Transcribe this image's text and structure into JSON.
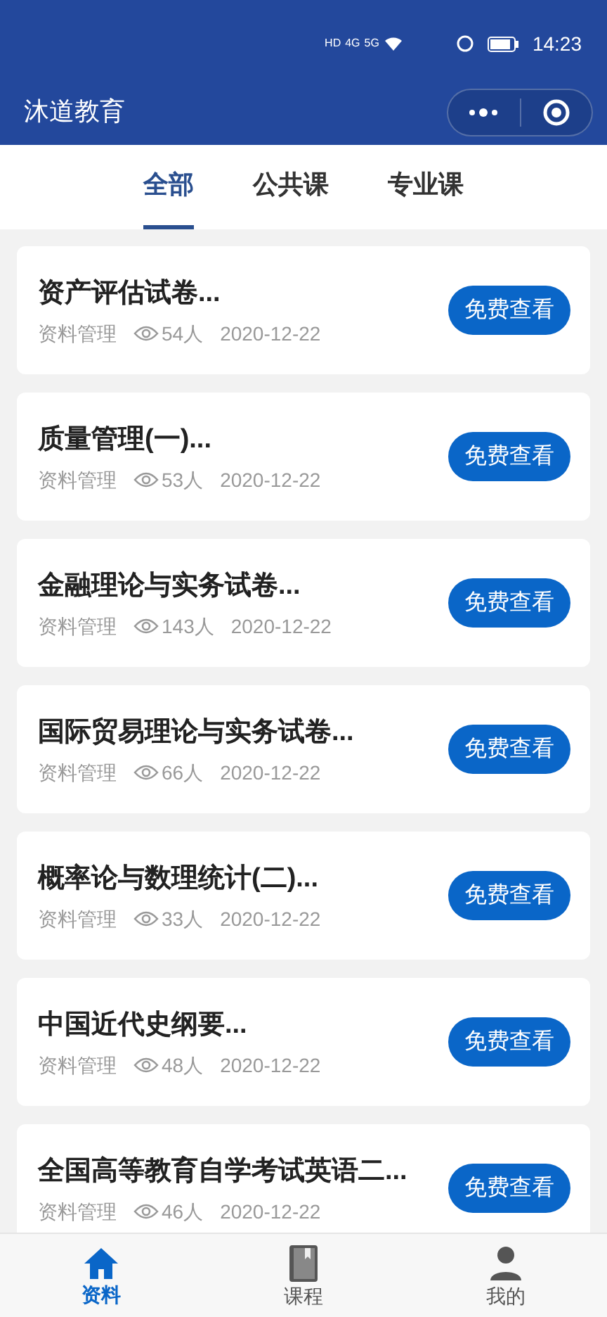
{
  "status_bar": {
    "badges": [
      "HD",
      "4G",
      "5G"
    ],
    "time": "14:23"
  },
  "header": {
    "title": "沐道教育"
  },
  "tabs": [
    {
      "label": "全部",
      "selected": true
    },
    {
      "label": "公共课",
      "selected": false
    },
    {
      "label": "专业课",
      "selected": false
    }
  ],
  "items": [
    {
      "title": "资产评估试卷...",
      "category": "资料管理",
      "views": "54人",
      "date": "2020-12-22",
      "action": "免费查看"
    },
    {
      "title": "质量管理(一)...",
      "category": "资料管理",
      "views": "53人",
      "date": "2020-12-22",
      "action": "免费查看"
    },
    {
      "title": "金融理论与实务试卷...",
      "category": "资料管理",
      "views": "143人",
      "date": "2020-12-22",
      "action": "免费查看"
    },
    {
      "title": "国际贸易理论与实务试卷...",
      "category": "资料管理",
      "views": "66人",
      "date": "2020-12-22",
      "action": "免费查看"
    },
    {
      "title": "概率论与数理统计(二)...",
      "category": "资料管理",
      "views": "33人",
      "date": "2020-12-22",
      "action": "免费查看"
    },
    {
      "title": "中国近代史纲要...",
      "category": "资料管理",
      "views": "48人",
      "date": "2020-12-22",
      "action": "免费查看"
    },
    {
      "title": "全国高等教育自学考试英语二...",
      "category": "资料管理",
      "views": "46人",
      "date": "2020-12-22",
      "action": "免费查看"
    }
  ],
  "bottom_nav": [
    {
      "label": "资料",
      "kind": "home",
      "selected": true
    },
    {
      "label": "课程",
      "kind": "book",
      "selected": false
    },
    {
      "label": "我的",
      "kind": "person",
      "selected": false
    }
  ]
}
